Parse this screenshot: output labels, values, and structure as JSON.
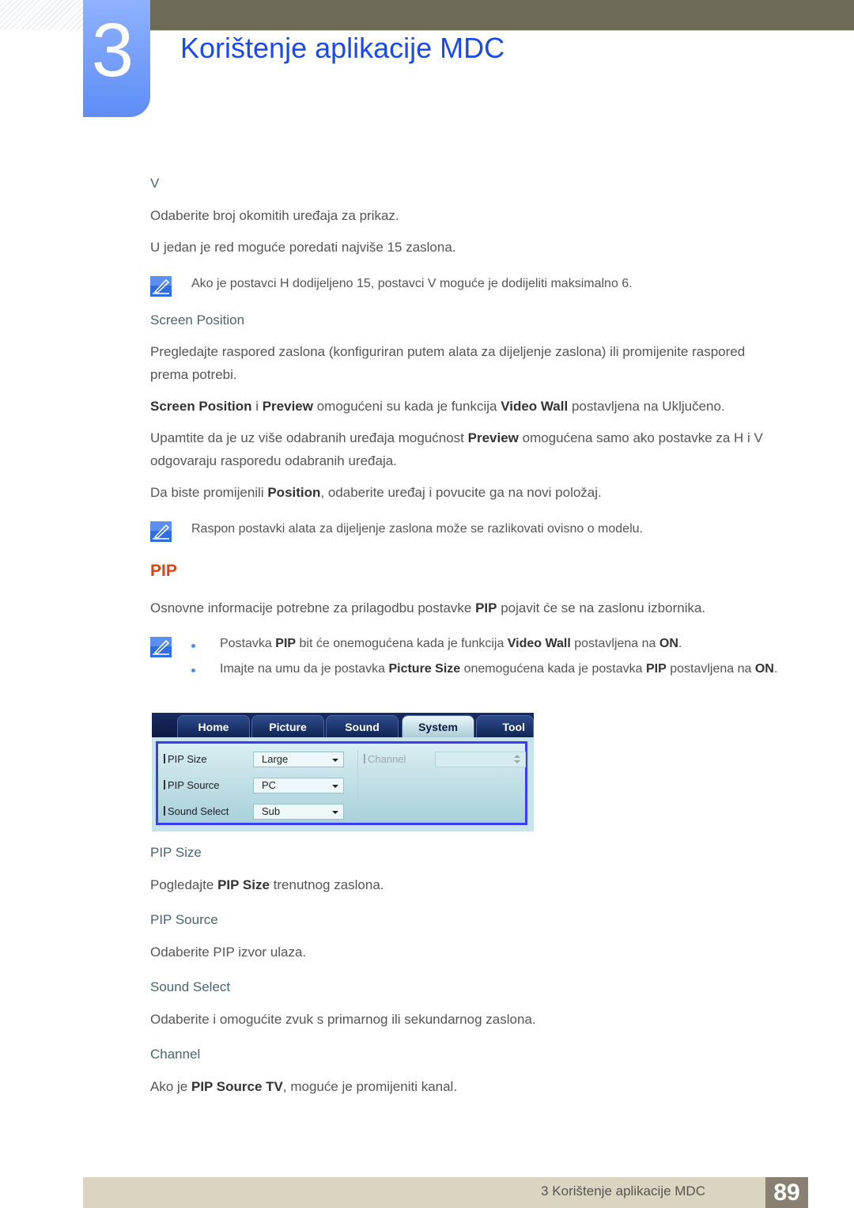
{
  "chapter": {
    "number": "3",
    "title": "Korištenje aplikacije MDC"
  },
  "content": {
    "v_heading": "V",
    "v_p1": "Odaberite broj okomitih uređaja za prikaz.",
    "v_p2": "U jedan je red moguće poredati najviše 15 zaslona.",
    "note1": "Ako je postavci H dodijeljeno 15, postavci V moguće je dodijeliti maksimalno 6.",
    "screen_position_heading": "Screen Position",
    "sp_p1": "Pregledajte raspored zaslona (konfiguriran putem alata za dijeljenje zaslona) ili promijenite raspored prema potrebi.",
    "sp_p2": {
      "b1": "Screen Position",
      "t1": " i ",
      "b2": "Preview",
      "t2": " omogućeni su kada je funkcija ",
      "b3": "Video Wall",
      "t3": " postavljena na Uključeno."
    },
    "sp_p3": {
      "t1": "Upamtite da je uz više odabranih uređaja mogućnost ",
      "b1": "Preview",
      "t2": " omogućena samo ako postavke za H i V odgovaraju rasporedu odabranih uređaja."
    },
    "sp_p4": {
      "t1": "Da biste promijenili ",
      "b1": "Position",
      "t2": ", odaberite uređaj i povucite ga na novi položaj."
    },
    "note2": "Raspon postavki alata za dijeljenje zaslona može se razlikovati ovisno o modelu.",
    "pip_heading": "PIP",
    "pip_p1": {
      "t1": "Osnovne informacije potrebne za prilagodbu postavke ",
      "b1": "PIP",
      "t2": " pojavit će se na zaslonu izbornika."
    },
    "bullets": [
      {
        "t1": "Postavka ",
        "b1": "PIP",
        "t2": " bit će onemogućena kada je funkcija ",
        "b2": "Video Wall",
        "t3": " postavljena na ",
        "b3": "ON",
        "t4": "."
      },
      {
        "t1": "Imajte na umu da je postavka ",
        "b1": "Picture Size",
        "t2": " onemogućena kada je postavka ",
        "b2": "PIP",
        "t3": " postavljena na ",
        "b3": "ON",
        "t4": "."
      }
    ],
    "pip_size_heading": "PIP Size",
    "pip_size_p": {
      "t1": "Pogledajte ",
      "b1": "PIP Size",
      "t2": " trenutnog zaslona."
    },
    "pip_source_heading": "PIP Source",
    "pip_source_p": "Odaberite PIP izvor ulaza.",
    "sound_select_heading": "Sound Select",
    "sound_select_p": "Odaberite i omogućite zvuk s primarnog ili sekundarnog zaslona.",
    "channel_heading": "Channel",
    "channel_p": {
      "t1": "Ako je ",
      "b1": "PIP Source TV",
      "t2": ", moguće je promijeniti kanal."
    }
  },
  "mdc": {
    "tabs": [
      "Home",
      "Picture",
      "Sound",
      "System",
      "Tool"
    ],
    "active_tab": "System",
    "fields": [
      {
        "label": "PIP Size",
        "value": "Large"
      },
      {
        "label": "PIP Source",
        "value": "PC"
      },
      {
        "label": "Sound Select",
        "value": "Sub"
      }
    ],
    "channel": {
      "label": "Channel",
      "value": "",
      "disabled": true
    }
  },
  "footer": {
    "text": "3 Korištenje aplikacije MDC",
    "page": "89"
  }
}
